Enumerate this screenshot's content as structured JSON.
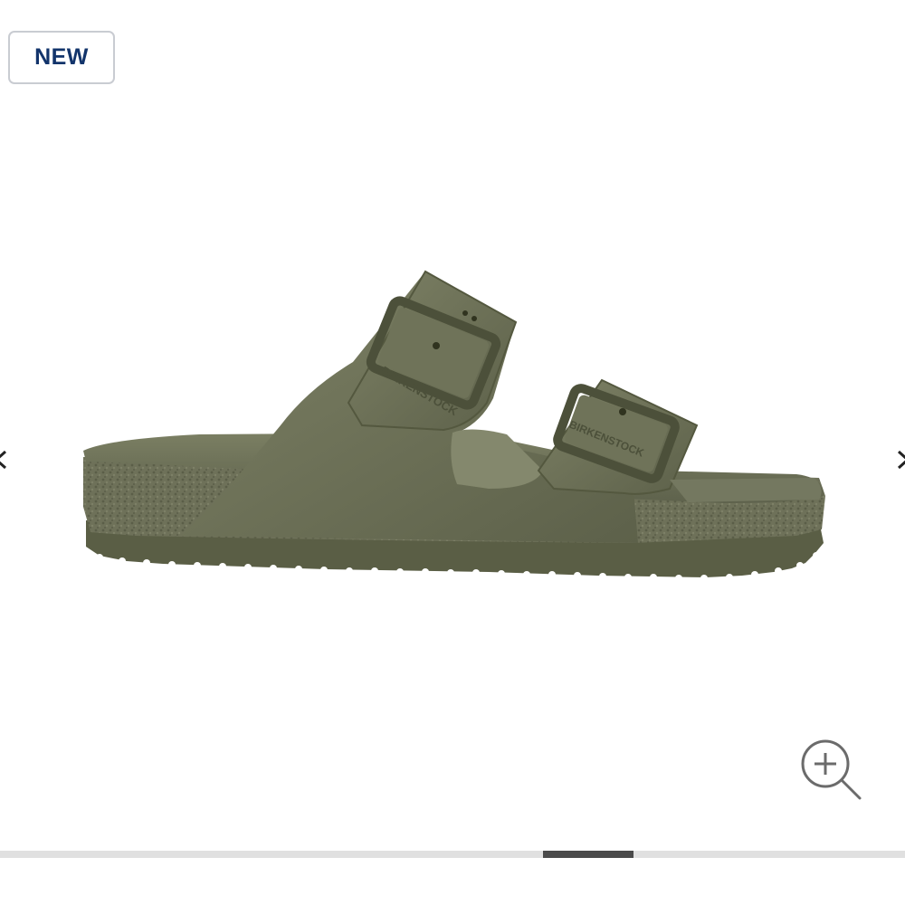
{
  "badge": {
    "label": "NEW"
  },
  "product_image": {
    "subject": "olive green two-strap sandal, side view",
    "strap_embossing": "BIRKENSTOCK",
    "color": "#656a52"
  },
  "navigation": {
    "prev_icon": "chevron-left-icon",
    "next_icon": "chevron-right-icon"
  },
  "zoom": {
    "icon": "zoom-in-icon"
  },
  "gallery_progress": {
    "total_slides": 10,
    "current_slide": 7
  },
  "colors": {
    "badge_text": "#12346b",
    "badge_border": "#c9ccd2",
    "track": "#e0e0e0",
    "thumb": "#4a4a4a",
    "icon_stroke": "#6b6b6b"
  }
}
